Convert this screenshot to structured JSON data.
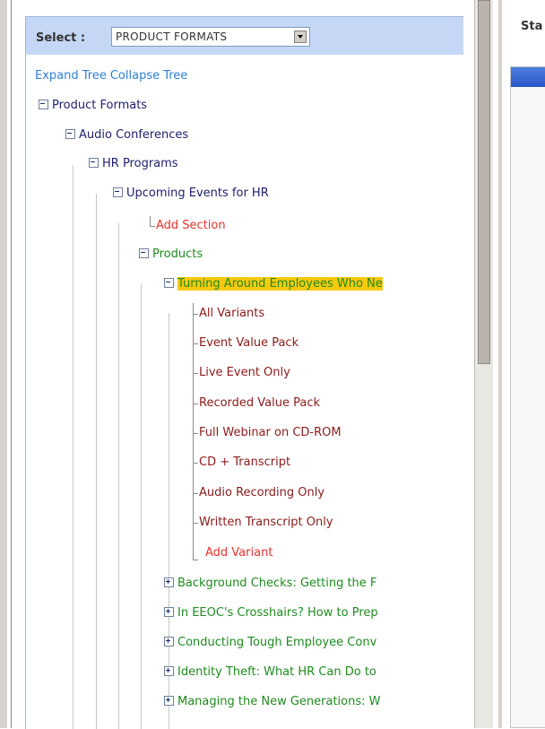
{
  "select": {
    "label": "Select :",
    "value": "PRODUCT FORMATS"
  },
  "tree_links": {
    "expand": "Expand Tree",
    "collapse": "Collapse Tree"
  },
  "tree": {
    "product_formats": "Product Formats",
    "audio_conferences": "Audio Conferences",
    "hr_programs": "HR Programs",
    "upcoming_events": "Upcoming Events for HR",
    "add_section": "Add Section",
    "products": "Products",
    "selected_product": "Turning Around Employees Who Ne",
    "variants": [
      "All Variants",
      "Event Value Pack",
      "Live Event Only",
      "Recorded Value Pack",
      "Full Webinar on CD-ROM",
      "CD + Transcript",
      "Audio Recording Only",
      "Written Transcript Only"
    ],
    "add_variant": "Add Variant",
    "collapsed_products": [
      "Background Checks: Getting the F",
      "In EEOC's Crosshairs? How to Prep",
      "Conducting Tough Employee Conv",
      "Identity Theft: What HR Can Do to",
      "Managing the New Generations: W"
    ]
  },
  "right_panel": {
    "label": "Sta"
  },
  "colors": {
    "select_bar": "#c5d7f5",
    "link": "#2f7fd6",
    "navy": "#20206e",
    "green": "#1f8a1f",
    "red": "#e8322b",
    "maroon": "#8b1a1a",
    "highlight": "#f6c90e"
  }
}
